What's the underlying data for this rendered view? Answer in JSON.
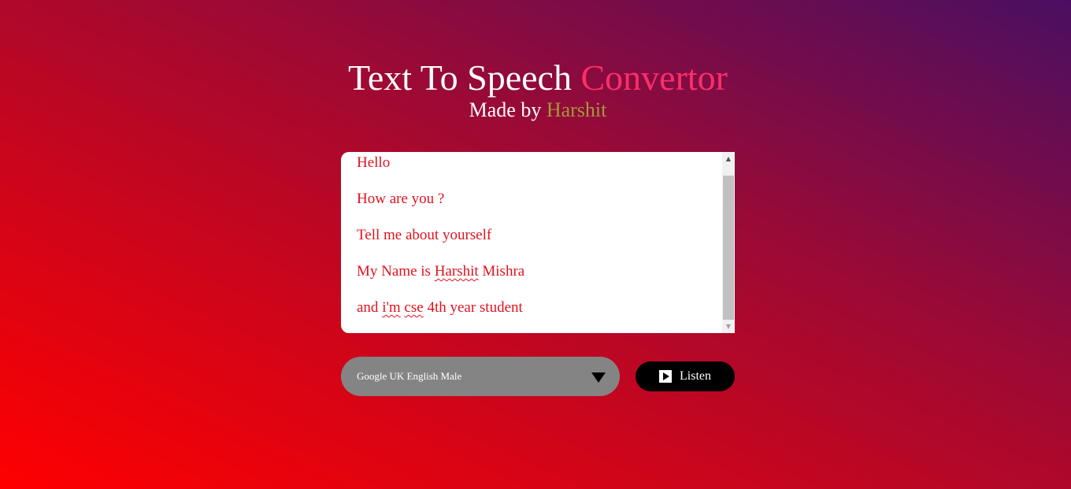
{
  "header": {
    "title_main": "Text To Speech",
    "title_accent": "Convertor",
    "subtitle_prefix": "Made by",
    "subtitle_author": "Harshit"
  },
  "editor": {
    "lines": [
      "Hello",
      "How are you ?",
      "Tell me about yourself",
      "My Name is Harshit Mishra",
      "and i'm cse 4th year student"
    ],
    "line4_before": "My Name is ",
    "line4_misspelled": "Harshit",
    "line4_after": " Mishra",
    "line5_before": "and ",
    "line5_misspelled_1": "i'm",
    "line5_middle": " ",
    "line5_misspelled_2": "cse",
    "line5_after": " 4th year student",
    "scroll_up_glyph": "▲",
    "scroll_down_glyph": "▼"
  },
  "controls": {
    "voice_selected": "Google UK English Male",
    "listen_label": "Listen"
  },
  "colors": {
    "text_red": "#e0121e",
    "title_accent": "#ff2d68",
    "author": "#a3983a",
    "select_bg": "#848484",
    "button_bg": "#000000"
  },
  "icons": {
    "dropdown": "triangle-down-icon",
    "play": "play-icon"
  }
}
